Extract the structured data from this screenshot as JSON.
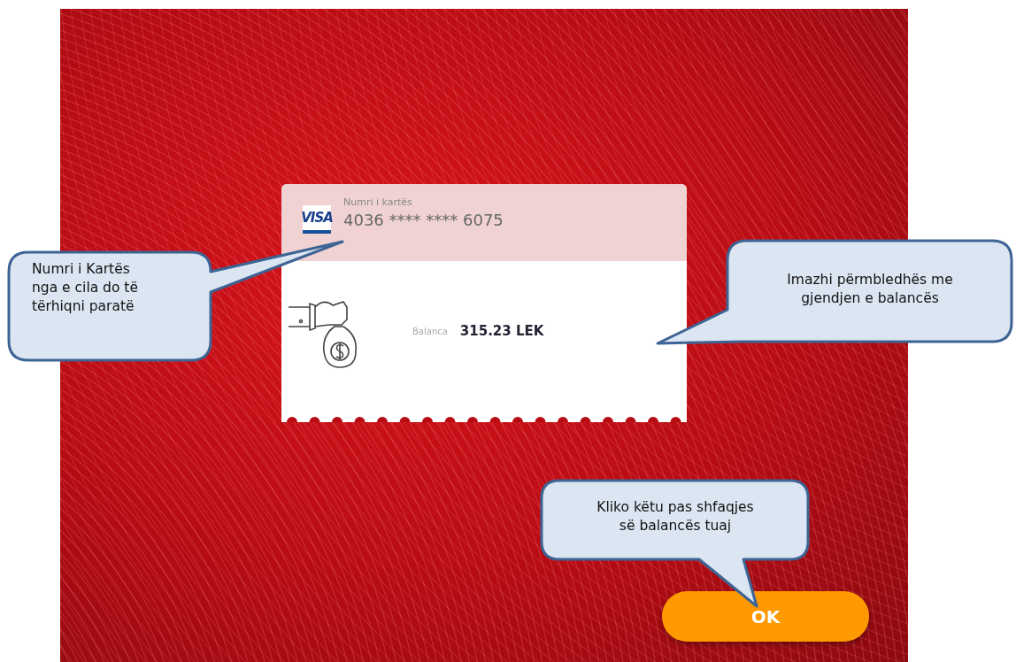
{
  "card": {
    "logo": "VISA",
    "number_label": "Numri i kartës",
    "number": "4036 **** **** 6075",
    "balance_label": "Balanca",
    "balance": "315.23 LEK"
  },
  "button": {
    "label": "OK"
  },
  "callouts": [
    {
      "lines": [
        "Numri i Kartës",
        "nga e cila do të",
        "tërhiqni paratë"
      ]
    },
    {
      "lines": [
        "Imazhi përmbledhës me",
        "gjendjen e balancës"
      ]
    },
    {
      "lines": [
        "Kliko këtu pas shfaqjes",
        "së balancës tuaj"
      ]
    }
  ]
}
